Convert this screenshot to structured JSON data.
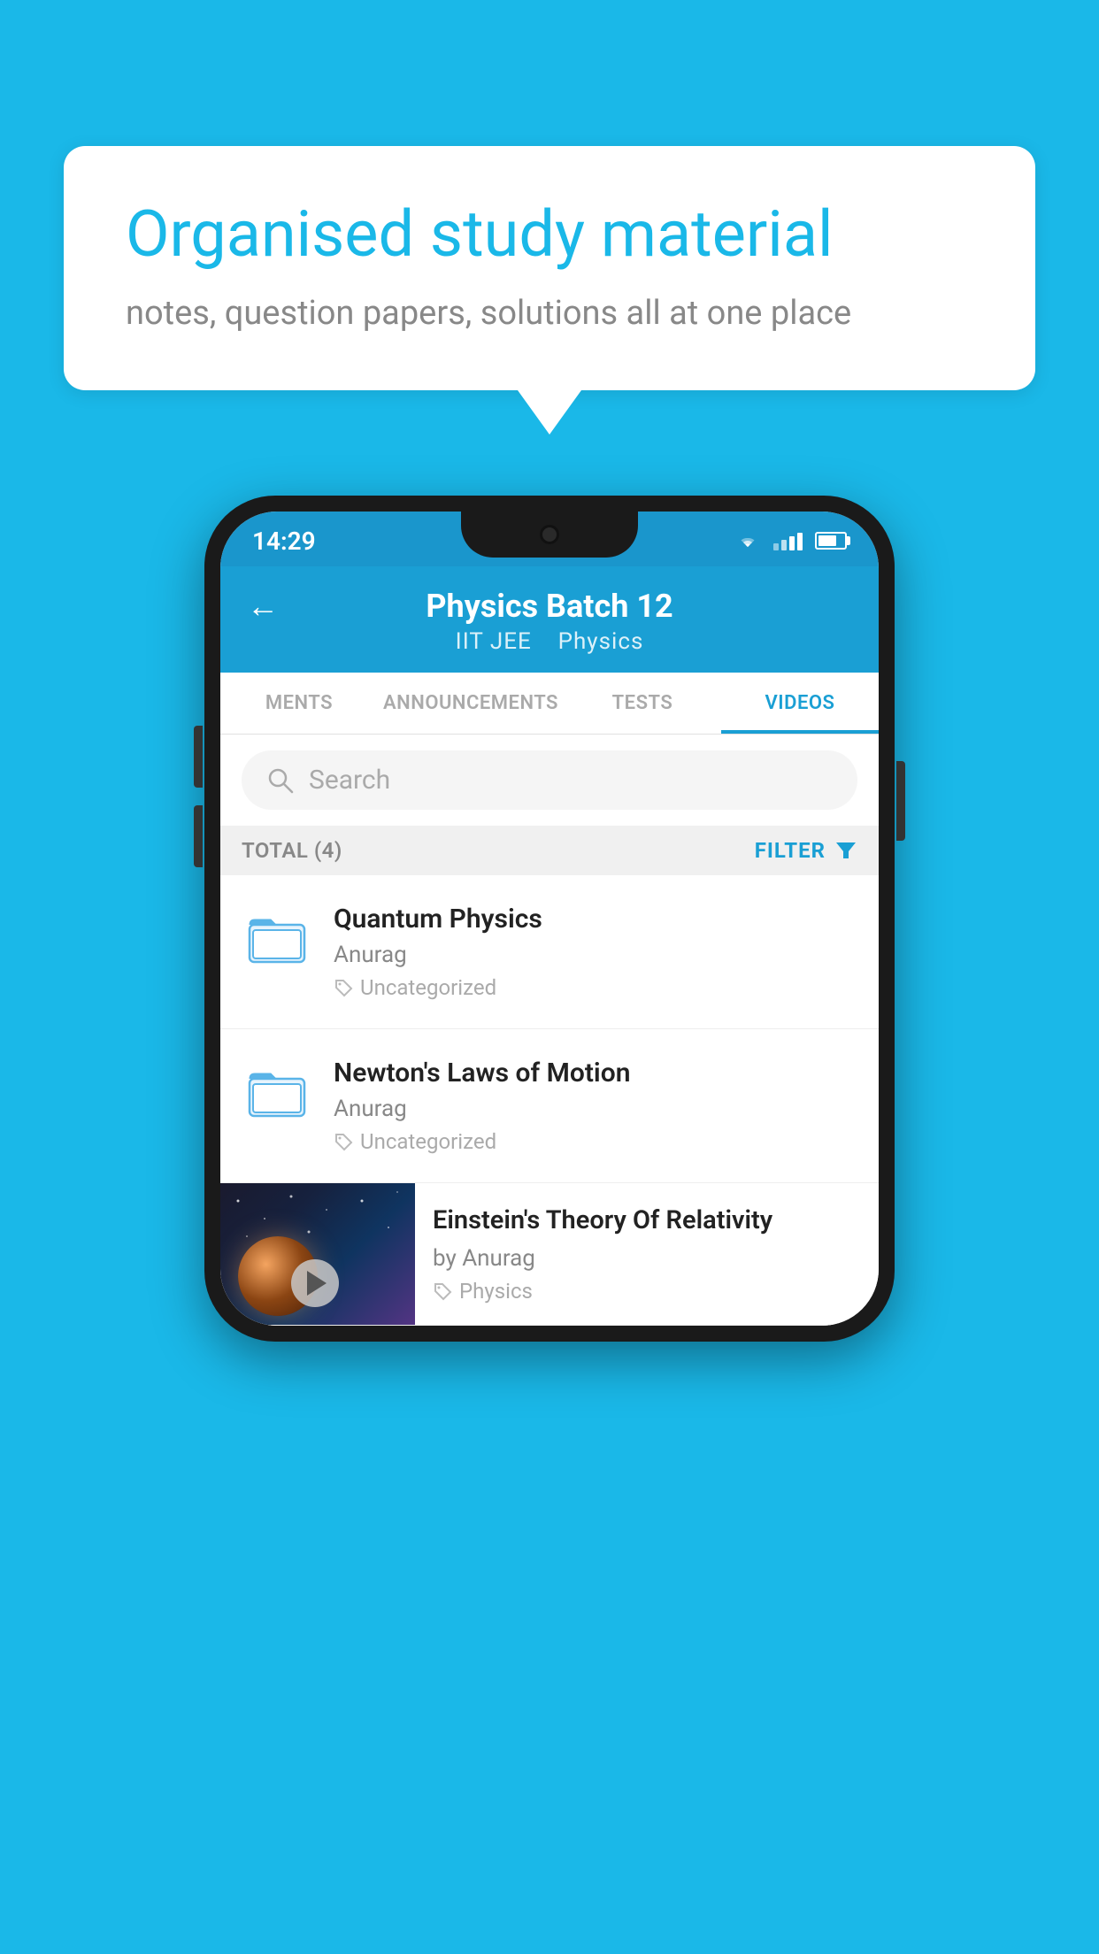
{
  "background_color": "#1ab8e8",
  "speech_bubble": {
    "title": "Organised study material",
    "subtitle": "notes, question papers, solutions all at one place"
  },
  "phone": {
    "status_bar": {
      "time": "14:29",
      "icons": [
        "wifi",
        "signal",
        "battery"
      ]
    },
    "header": {
      "back_label": "←",
      "title": "Physics Batch 12",
      "subtitle_part1": "IIT JEE",
      "subtitle_part2": "Physics"
    },
    "tabs": [
      {
        "label": "MENTS",
        "active": false
      },
      {
        "label": "ANNOUNCEMENTS",
        "active": false
      },
      {
        "label": "TESTS",
        "active": false
      },
      {
        "label": "VIDEOS",
        "active": true
      }
    ],
    "search": {
      "placeholder": "Search"
    },
    "filter_row": {
      "total_label": "TOTAL (4)",
      "filter_label": "FILTER"
    },
    "video_items": [
      {
        "id": 1,
        "title": "Quantum Physics",
        "author": "Anurag",
        "tag": "Uncategorized",
        "type": "folder"
      },
      {
        "id": 2,
        "title": "Newton's Laws of Motion",
        "author": "Anurag",
        "tag": "Uncategorized",
        "type": "folder"
      },
      {
        "id": 3,
        "title": "Einstein's Theory Of Relativity",
        "author": "by Anurag",
        "tag": "Physics",
        "type": "video"
      }
    ]
  }
}
